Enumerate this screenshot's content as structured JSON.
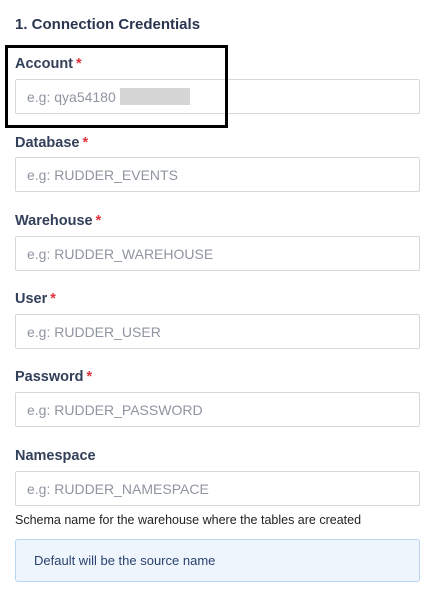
{
  "section": {
    "title": "1. Connection Credentials"
  },
  "required_marker": "*",
  "fields": [
    {
      "label": "Account",
      "required": true,
      "placeholder": "e.g: qya54180",
      "value": ""
    },
    {
      "label": "Database",
      "required": true,
      "placeholder": "e.g: RUDDER_EVENTS",
      "value": ""
    },
    {
      "label": "Warehouse",
      "required": true,
      "placeholder": "e.g: RUDDER_WAREHOUSE",
      "value": ""
    },
    {
      "label": "User",
      "required": true,
      "placeholder": "e.g: RUDDER_USER",
      "value": ""
    },
    {
      "label": "Password",
      "required": true,
      "placeholder": "e.g: RUDDER_PASSWORD",
      "value": ""
    },
    {
      "label": "Namespace",
      "required": false,
      "placeholder": "e.g: RUDDER_NAMESPACE",
      "value": ""
    }
  ],
  "namespace_help": "Schema name for the warehouse where the tables are created",
  "info_box": {
    "text": "Default will be the source name"
  },
  "colors": {
    "required": "#e0343b",
    "label": "#33405a",
    "info_bg": "#eef5fc",
    "info_border": "#b9d6f1",
    "highlight_border": "#000000"
  }
}
